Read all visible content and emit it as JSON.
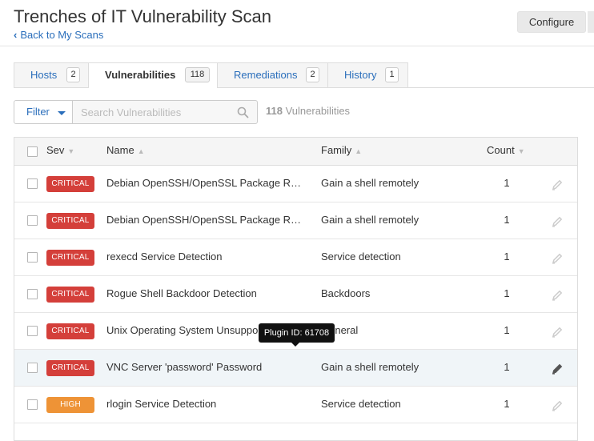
{
  "header": {
    "title": "Trenches of IT Vulnerability Scan",
    "back_label": "Back to My Scans",
    "configure_label": "Configure"
  },
  "tabs": [
    {
      "label": "Hosts",
      "count": "2",
      "active": false
    },
    {
      "label": "Vulnerabilities",
      "count": "118",
      "active": true
    },
    {
      "label": "Remediations",
      "count": "2",
      "active": false
    },
    {
      "label": "History",
      "count": "1",
      "active": false
    }
  ],
  "toolbar": {
    "filter_label": "Filter",
    "search_placeholder": "Search Vulnerabilities",
    "count_number": "118",
    "count_label": "Vulnerabilities"
  },
  "table": {
    "columns": {
      "sev": "Sev",
      "name": "Name",
      "family": "Family",
      "count": "Count"
    },
    "rows": [
      {
        "severity": "CRITICAL",
        "name": "Debian OpenSSH/OpenSSL Package Random Number Generator Weakness",
        "family": "Gain a shell remotely",
        "count": "1"
      },
      {
        "severity": "CRITICAL",
        "name": "Debian OpenSSH/OpenSSL Package Random Number Generator Weakness (SSL check)",
        "family": "Gain a shell remotely",
        "count": "1"
      },
      {
        "severity": "CRITICAL",
        "name": "rexecd Service Detection",
        "family": "Service detection",
        "count": "1"
      },
      {
        "severity": "CRITICAL",
        "name": "Rogue Shell Backdoor Detection",
        "family": "Backdoors",
        "count": "1"
      },
      {
        "severity": "CRITICAL",
        "name": "Unix Operating System Unsupported Version Detection",
        "family": "General",
        "count": "1"
      },
      {
        "severity": "CRITICAL",
        "name": "VNC Server 'password' Password",
        "family": "Gain a shell remotely",
        "count": "1"
      },
      {
        "severity": "HIGH",
        "name": "rlogin Service Detection",
        "family": "Service detection",
        "count": "1"
      }
    ]
  },
  "tooltip": {
    "text": "Plugin ID: 61708"
  },
  "colors": {
    "link": "#2a6ebb",
    "critical": "#d43f3a",
    "high": "#ee9336"
  }
}
